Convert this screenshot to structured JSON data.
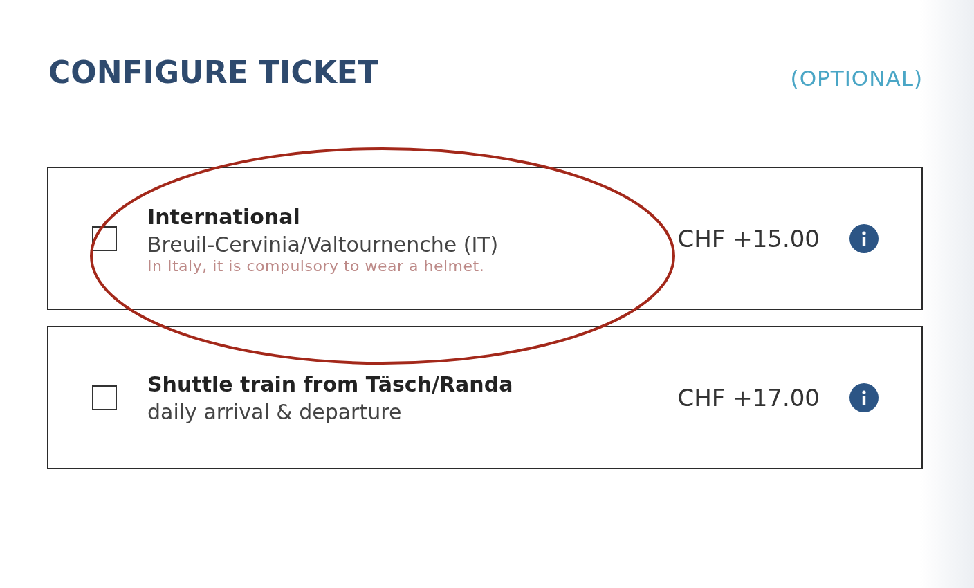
{
  "section": {
    "title": "CONFIGURE TICKET",
    "hint": "(OPTIONAL)"
  },
  "options": [
    {
      "title": "International",
      "subtitle": "Breuil-Cervinia/Valtournenche (IT)",
      "note": "In Italy, it is compulsory to wear a helmet.",
      "price": "CHF +15.00",
      "checked": false,
      "circled": true
    },
    {
      "title": "Shuttle train from Täsch/Randa",
      "subtitle": "daily arrival & departure",
      "price": "CHF +17.00",
      "checked": false,
      "circled": false
    }
  ]
}
